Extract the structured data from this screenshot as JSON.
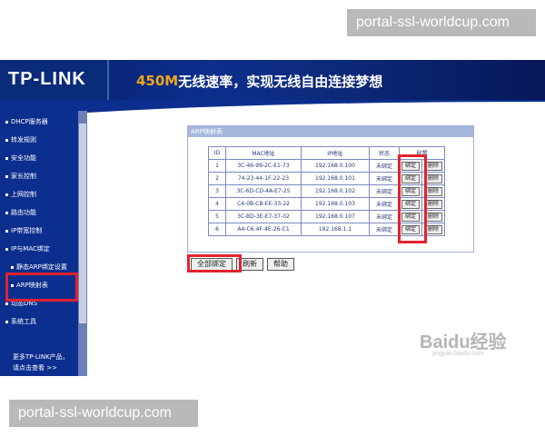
{
  "captions": {
    "top": "portal-ssl-worldcup.com",
    "bottom": "portal-ssl-worldcup.com"
  },
  "banner": {
    "logo": "TP-LINK",
    "slogan_accent": "450M",
    "slogan_rest": "无线速率，实现无线自由连接梦想"
  },
  "sidebar": {
    "items": [
      "DHCP服务器",
      "转发规则",
      "安全功能",
      "家长控制",
      "上网控制",
      "路由功能",
      "IP带宽控制",
      "IP与MAC绑定",
      "静态ARP绑定设置",
      "ARP映射表",
      "动态DNS",
      "系统工具"
    ],
    "footer_line1": "更多TP-LINK产品，",
    "footer_line2": "请点击查看 >>"
  },
  "panel": {
    "title": "ARP映射表",
    "columns": [
      "ID",
      "MAC地址",
      "IP地址",
      "状态",
      "配置"
    ],
    "rows": [
      {
        "id": "1",
        "mac": "3C-46-99-2C-E1-73",
        "ip": "192.168.0.100",
        "status": "未绑定",
        "bind": "绑定",
        "delete": "删除"
      },
      {
        "id": "2",
        "mac": "74-23-44-1F-22-23",
        "ip": "192.168.0.101",
        "status": "未绑定",
        "bind": "绑定",
        "delete": "删除"
      },
      {
        "id": "3",
        "mac": "3C-6D-CD-4A-E7-25",
        "ip": "192.168.0.102",
        "status": "未绑定",
        "bind": "绑定",
        "delete": "删除"
      },
      {
        "id": "4",
        "mac": "C4-0B-CB-EE-33-22",
        "ip": "192.168.0.103",
        "status": "未绑定",
        "bind": "绑定",
        "delete": "删除"
      },
      {
        "id": "5",
        "mac": "3C-BD-3E-E7-37-02",
        "ip": "192.168.0.107",
        "status": "未绑定",
        "bind": "绑定",
        "delete": "删除"
      },
      {
        "id": "6",
        "mac": "A4-C6-4F-4E-26-C1",
        "ip": "192.168.1.1",
        "status": "未绑定",
        "bind": "绑定",
        "delete": "删除"
      }
    ]
  },
  "buttons": {
    "bind_all": "全部绑定",
    "refresh": "刷新",
    "help": "帮助"
  },
  "watermark": {
    "main": "Baidu经验",
    "sub": "jingyan.baidu.com"
  },
  "colors": {
    "highlight": "#e1232e",
    "sidebar": "#0c2e8e"
  }
}
